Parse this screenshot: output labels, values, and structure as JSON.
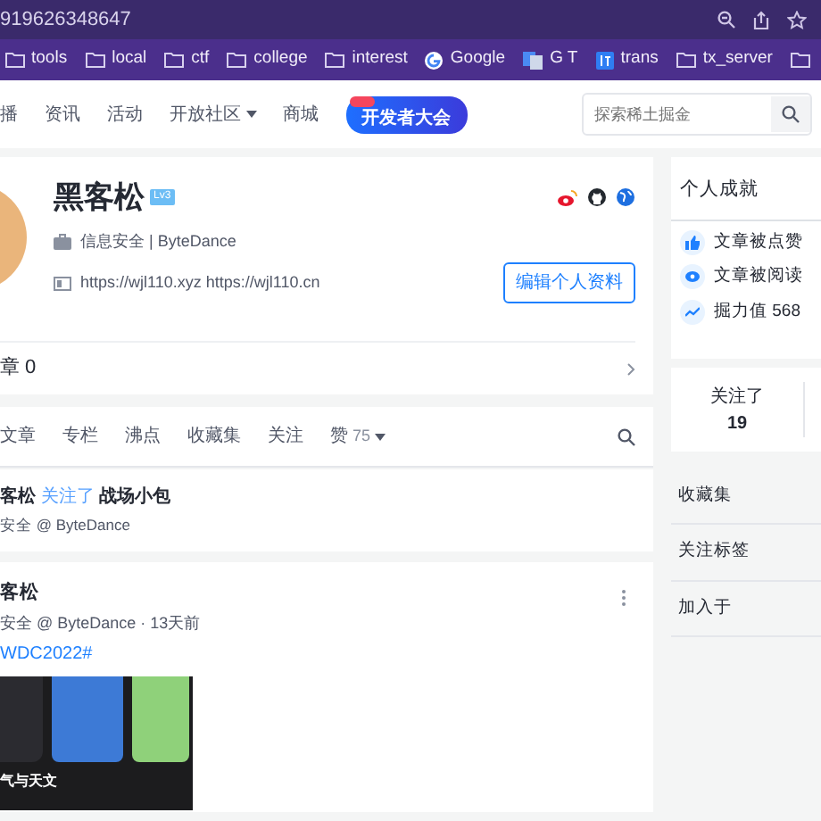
{
  "browser": {
    "url": "919626348647",
    "bookmarks": [
      {
        "kind": "folder",
        "label": "tools"
      },
      {
        "kind": "folder",
        "label": "local"
      },
      {
        "kind": "folder",
        "label": "ctf"
      },
      {
        "kind": "folder",
        "label": "college"
      },
      {
        "kind": "folder",
        "label": "interest"
      },
      {
        "kind": "google",
        "label": "Google"
      },
      {
        "kind": "translate",
        "label": "G T"
      },
      {
        "kind": "trans",
        "label": "trans"
      },
      {
        "kind": "folder",
        "label": "tx_server"
      },
      {
        "kind": "folder"
      }
    ]
  },
  "nav": {
    "items": [
      {
        "label": "播",
        "dropdown": false
      },
      {
        "label": "资讯",
        "dropdown": false
      },
      {
        "label": "活动",
        "dropdown": false
      },
      {
        "label": "开放社区",
        "dropdown": true
      },
      {
        "label": "商城",
        "dropdown": false
      }
    ],
    "event_badge": "开发者大会",
    "search": {
      "placeholder": "探索稀土掘金"
    }
  },
  "profile": {
    "name": "黑客松",
    "level": "Lv3",
    "job": "信息安全 | ByteDance",
    "links": "https://wjl110.xyz https://wjl110.cn",
    "edit_button": "编辑个人资料",
    "badges": "章 0"
  },
  "tabs": [
    {
      "label": "文章",
      "selected": false
    },
    {
      "label": "专栏",
      "selected": false
    },
    {
      "label": "沸点",
      "selected": false
    },
    {
      "label": "收藏集",
      "selected": false
    },
    {
      "label": "关注",
      "selected": false
    },
    {
      "label": "赞",
      "count": "75",
      "selected": false
    }
  ],
  "activity": {
    "user": "客松",
    "action": "关注了",
    "target": "战场小包",
    "meta": "安全 @ ByteDance"
  },
  "post": {
    "author": "客松",
    "meta": "安全 @ ByteDance",
    "separator": "·",
    "time": "13天前",
    "topic": "WDC2022#",
    "image_caption": "气与天文"
  },
  "achievements": {
    "title": "个人成就",
    "items": [
      {
        "kind": "like",
        "text": "文章被点赞"
      },
      {
        "kind": "view",
        "text": "文章被阅读"
      },
      {
        "kind": "power",
        "text": "掘力值 568"
      }
    ]
  },
  "follow": {
    "label": "关注了",
    "count": "19"
  },
  "side_links": [
    "收藏集",
    "关注标签",
    "加入于"
  ]
}
